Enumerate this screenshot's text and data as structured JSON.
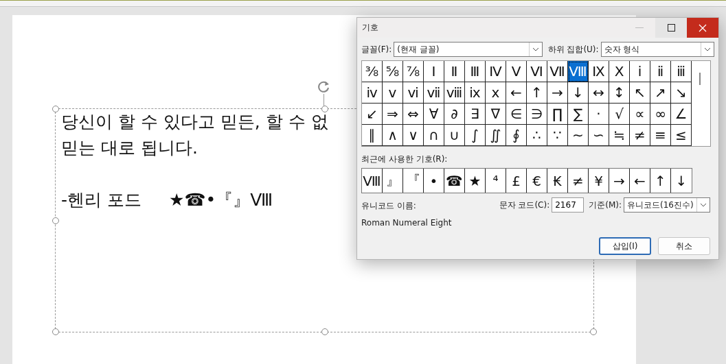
{
  "slide": {
    "lines": [
      "당신이 할 수 있다고 믿든, 할 수 없",
      "믿는 대로 됩니다."
    ],
    "signature": "-헨리 포드",
    "inserted_symbols": "★☎•『』Ⅷ"
  },
  "dialog": {
    "title": "기호",
    "font_label": "글꼴(F):",
    "font_value": "(현재 글꼴)",
    "subset_label": "하위 집합(U):",
    "subset_value": "숫자 형식",
    "symbols": [
      {
        "char": "⅜",
        "selected": false
      },
      {
        "char": "⅝",
        "selected": false
      },
      {
        "char": "⅞",
        "selected": false
      },
      {
        "char": "Ⅰ",
        "selected": false
      },
      {
        "char": "Ⅱ",
        "selected": false
      },
      {
        "char": "Ⅲ",
        "selected": false
      },
      {
        "char": "Ⅳ",
        "selected": false
      },
      {
        "char": "Ⅴ",
        "selected": false
      },
      {
        "char": "Ⅵ",
        "selected": false
      },
      {
        "char": "Ⅶ",
        "selected": false
      },
      {
        "char": "Ⅷ",
        "selected": true
      },
      {
        "char": "Ⅸ",
        "selected": false
      },
      {
        "char": "Ⅹ",
        "selected": false
      },
      {
        "char": "ⅰ",
        "selected": false
      },
      {
        "char": "ⅱ",
        "selected": false
      },
      {
        "char": "ⅲ",
        "selected": false
      },
      {
        "char": "ⅳ",
        "selected": false
      },
      {
        "char": "ⅴ",
        "selected": false
      },
      {
        "char": "ⅵ",
        "selected": false
      },
      {
        "char": "ⅶ",
        "selected": false
      },
      {
        "char": "ⅷ",
        "selected": false
      },
      {
        "char": "ⅸ",
        "selected": false
      },
      {
        "char": "ⅹ",
        "selected": false
      },
      {
        "char": "←",
        "selected": false
      },
      {
        "char": "↑",
        "selected": false
      },
      {
        "char": "→",
        "selected": false
      },
      {
        "char": "↓",
        "selected": false
      },
      {
        "char": "↔",
        "selected": false
      },
      {
        "char": "↕",
        "selected": false
      },
      {
        "char": "↖",
        "selected": false
      },
      {
        "char": "↗",
        "selected": false
      },
      {
        "char": "↘",
        "selected": false
      },
      {
        "char": "↙",
        "selected": false
      },
      {
        "char": "⇒",
        "selected": false
      },
      {
        "char": "⇔",
        "selected": false
      },
      {
        "char": "∀",
        "selected": false
      },
      {
        "char": "∂",
        "selected": false
      },
      {
        "char": "∃",
        "selected": false
      },
      {
        "char": "∇",
        "selected": false
      },
      {
        "char": "∈",
        "selected": false
      },
      {
        "char": "∋",
        "selected": false
      },
      {
        "char": "∏",
        "selected": false
      },
      {
        "char": "∑",
        "selected": false
      },
      {
        "char": "·",
        "selected": false
      },
      {
        "char": "√",
        "selected": false
      },
      {
        "char": "∝",
        "selected": false
      },
      {
        "char": "∞",
        "selected": false
      },
      {
        "char": "∠",
        "selected": false
      },
      {
        "char": "∥",
        "selected": false
      },
      {
        "char": "∧",
        "selected": false
      },
      {
        "char": "∨",
        "selected": false
      },
      {
        "char": "∩",
        "selected": false
      },
      {
        "char": "∪",
        "selected": false
      },
      {
        "char": "∫",
        "selected": false
      },
      {
        "char": "∬",
        "selected": false
      },
      {
        "char": "∮",
        "selected": false
      },
      {
        "char": "∴",
        "selected": false
      },
      {
        "char": "∵",
        "selected": false
      },
      {
        "char": "∼",
        "selected": false
      },
      {
        "char": "∽",
        "selected": false
      },
      {
        "char": "≒",
        "selected": false
      },
      {
        "char": "≠",
        "selected": false
      },
      {
        "char": "≡",
        "selected": false
      },
      {
        "char": "≤",
        "selected": false
      }
    ],
    "recent_label": "최근에 사용한 기호(R):",
    "recent": [
      "Ⅷ",
      "』",
      "『",
      "•",
      "☎",
      "★",
      "⁴",
      "£",
      "€",
      "₭",
      "≠",
      "¥",
      "→",
      "←",
      "↑",
      "↓"
    ],
    "unicode_name_label": "유니코드 이름:",
    "unicode_name": "Roman Numeral Eight",
    "char_code_label": "문자 코드(C):",
    "char_code": "2167",
    "from_label": "기준(M):",
    "from_value": "유니코드(16진수)",
    "buttons": [
      {
        "label": "삽입(I)",
        "default": true
      },
      {
        "label": "취소",
        "default": false
      }
    ]
  }
}
